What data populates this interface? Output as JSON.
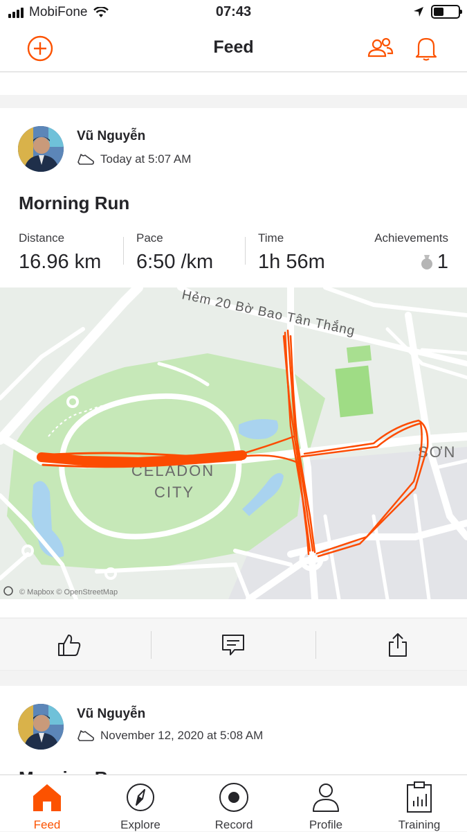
{
  "status_bar": {
    "carrier": "MobiFone",
    "time": "07:43",
    "battery_level": 0.4
  },
  "header": {
    "title": "Feed",
    "icons": [
      "add-circle-icon",
      "find-friends-icon",
      "bell-icon"
    ]
  },
  "colors": {
    "brand": "#fc5200",
    "route": "#fc4c02",
    "text": "#242428",
    "park": "#bfe6b0",
    "water": "#a9d3ef"
  },
  "activities": [
    {
      "athlete": "Vũ Nguyễn",
      "timestamp": "Today at 5:07 AM",
      "title": "Morning Run",
      "stats": [
        {
          "label": "Distance",
          "value": "16.96 km"
        },
        {
          "label": "Pace",
          "value": "6:50 /km"
        },
        {
          "label": "Time",
          "value": "1h 56m"
        },
        {
          "label": "Achievements",
          "value": "1"
        }
      ],
      "map": {
        "street_label": "Hẻm 20 Bờ Bao Tân Thắng",
        "area_label_1": "CELADON",
        "area_label_2": "CITY",
        "district_label": "SƠN",
        "attribution": "© Mapbox © OpenStreetMap"
      }
    },
    {
      "athlete": "Vũ Nguyễn",
      "timestamp": "November 12, 2020 at 5:08 AM",
      "title": "Morning Run"
    }
  ],
  "action_icons": [
    "kudos-icon",
    "comment-icon",
    "share-icon"
  ],
  "tabs": [
    {
      "label": "Feed",
      "icon": "home-icon",
      "active": true
    },
    {
      "label": "Explore",
      "icon": "compass-icon",
      "active": false
    },
    {
      "label": "Record",
      "icon": "record-icon",
      "active": false
    },
    {
      "label": "Profile",
      "icon": "profile-icon",
      "active": false
    },
    {
      "label": "Training",
      "icon": "training-icon",
      "active": false
    }
  ]
}
